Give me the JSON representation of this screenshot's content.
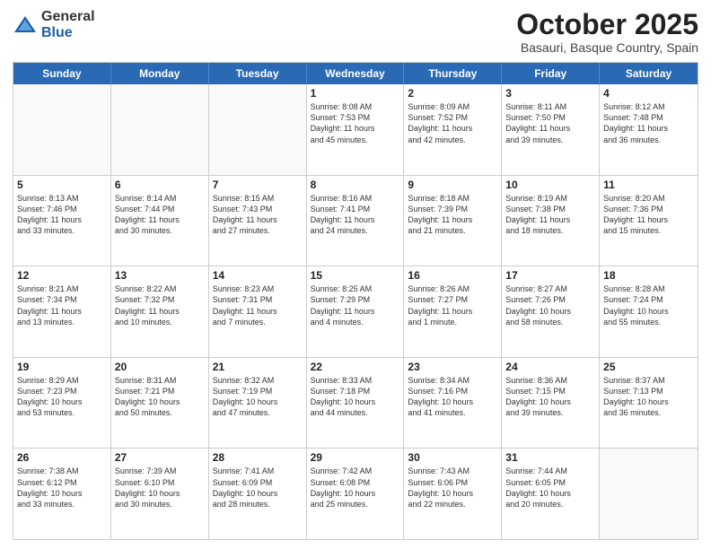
{
  "logo": {
    "general": "General",
    "blue": "Blue"
  },
  "header": {
    "month": "October 2025",
    "location": "Basauri, Basque Country, Spain"
  },
  "days": [
    "Sunday",
    "Monday",
    "Tuesday",
    "Wednesday",
    "Thursday",
    "Friday",
    "Saturday"
  ],
  "weeks": [
    [
      {
        "day": "",
        "text": ""
      },
      {
        "day": "",
        "text": ""
      },
      {
        "day": "",
        "text": ""
      },
      {
        "day": "1",
        "text": "Sunrise: 8:08 AM\nSunset: 7:53 PM\nDaylight: 11 hours\nand 45 minutes."
      },
      {
        "day": "2",
        "text": "Sunrise: 8:09 AM\nSunset: 7:52 PM\nDaylight: 11 hours\nand 42 minutes."
      },
      {
        "day": "3",
        "text": "Sunrise: 8:11 AM\nSunset: 7:50 PM\nDaylight: 11 hours\nand 39 minutes."
      },
      {
        "day": "4",
        "text": "Sunrise: 8:12 AM\nSunset: 7:48 PM\nDaylight: 11 hours\nand 36 minutes."
      }
    ],
    [
      {
        "day": "5",
        "text": "Sunrise: 8:13 AM\nSunset: 7:46 PM\nDaylight: 11 hours\nand 33 minutes."
      },
      {
        "day": "6",
        "text": "Sunrise: 8:14 AM\nSunset: 7:44 PM\nDaylight: 11 hours\nand 30 minutes."
      },
      {
        "day": "7",
        "text": "Sunrise: 8:15 AM\nSunset: 7:43 PM\nDaylight: 11 hours\nand 27 minutes."
      },
      {
        "day": "8",
        "text": "Sunrise: 8:16 AM\nSunset: 7:41 PM\nDaylight: 11 hours\nand 24 minutes."
      },
      {
        "day": "9",
        "text": "Sunrise: 8:18 AM\nSunset: 7:39 PM\nDaylight: 11 hours\nand 21 minutes."
      },
      {
        "day": "10",
        "text": "Sunrise: 8:19 AM\nSunset: 7:38 PM\nDaylight: 11 hours\nand 18 minutes."
      },
      {
        "day": "11",
        "text": "Sunrise: 8:20 AM\nSunset: 7:36 PM\nDaylight: 11 hours\nand 15 minutes."
      }
    ],
    [
      {
        "day": "12",
        "text": "Sunrise: 8:21 AM\nSunset: 7:34 PM\nDaylight: 11 hours\nand 13 minutes."
      },
      {
        "day": "13",
        "text": "Sunrise: 8:22 AM\nSunset: 7:32 PM\nDaylight: 11 hours\nand 10 minutes."
      },
      {
        "day": "14",
        "text": "Sunrise: 8:23 AM\nSunset: 7:31 PM\nDaylight: 11 hours\nand 7 minutes."
      },
      {
        "day": "15",
        "text": "Sunrise: 8:25 AM\nSunset: 7:29 PM\nDaylight: 11 hours\nand 4 minutes."
      },
      {
        "day": "16",
        "text": "Sunrise: 8:26 AM\nSunset: 7:27 PM\nDaylight: 11 hours\nand 1 minute."
      },
      {
        "day": "17",
        "text": "Sunrise: 8:27 AM\nSunset: 7:26 PM\nDaylight: 10 hours\nand 58 minutes."
      },
      {
        "day": "18",
        "text": "Sunrise: 8:28 AM\nSunset: 7:24 PM\nDaylight: 10 hours\nand 55 minutes."
      }
    ],
    [
      {
        "day": "19",
        "text": "Sunrise: 8:29 AM\nSunset: 7:23 PM\nDaylight: 10 hours\nand 53 minutes."
      },
      {
        "day": "20",
        "text": "Sunrise: 8:31 AM\nSunset: 7:21 PM\nDaylight: 10 hours\nand 50 minutes."
      },
      {
        "day": "21",
        "text": "Sunrise: 8:32 AM\nSunset: 7:19 PM\nDaylight: 10 hours\nand 47 minutes."
      },
      {
        "day": "22",
        "text": "Sunrise: 8:33 AM\nSunset: 7:18 PM\nDaylight: 10 hours\nand 44 minutes."
      },
      {
        "day": "23",
        "text": "Sunrise: 8:34 AM\nSunset: 7:16 PM\nDaylight: 10 hours\nand 41 minutes."
      },
      {
        "day": "24",
        "text": "Sunrise: 8:36 AM\nSunset: 7:15 PM\nDaylight: 10 hours\nand 39 minutes."
      },
      {
        "day": "25",
        "text": "Sunrise: 8:37 AM\nSunset: 7:13 PM\nDaylight: 10 hours\nand 36 minutes."
      }
    ],
    [
      {
        "day": "26",
        "text": "Sunrise: 7:38 AM\nSunset: 6:12 PM\nDaylight: 10 hours\nand 33 minutes."
      },
      {
        "day": "27",
        "text": "Sunrise: 7:39 AM\nSunset: 6:10 PM\nDaylight: 10 hours\nand 30 minutes."
      },
      {
        "day": "28",
        "text": "Sunrise: 7:41 AM\nSunset: 6:09 PM\nDaylight: 10 hours\nand 28 minutes."
      },
      {
        "day": "29",
        "text": "Sunrise: 7:42 AM\nSunset: 6:08 PM\nDaylight: 10 hours\nand 25 minutes."
      },
      {
        "day": "30",
        "text": "Sunrise: 7:43 AM\nSunset: 6:06 PM\nDaylight: 10 hours\nand 22 minutes."
      },
      {
        "day": "31",
        "text": "Sunrise: 7:44 AM\nSunset: 6:05 PM\nDaylight: 10 hours\nand 20 minutes."
      },
      {
        "day": "",
        "text": ""
      }
    ]
  ]
}
